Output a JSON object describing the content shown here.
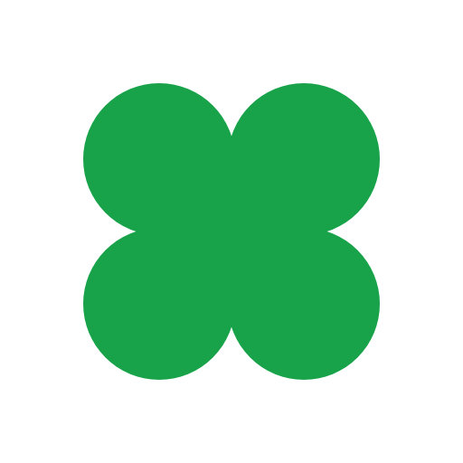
{
  "icon": {
    "name": "clover-cross-icon",
    "color": "#18a34a",
    "background": "#ffffff"
  }
}
